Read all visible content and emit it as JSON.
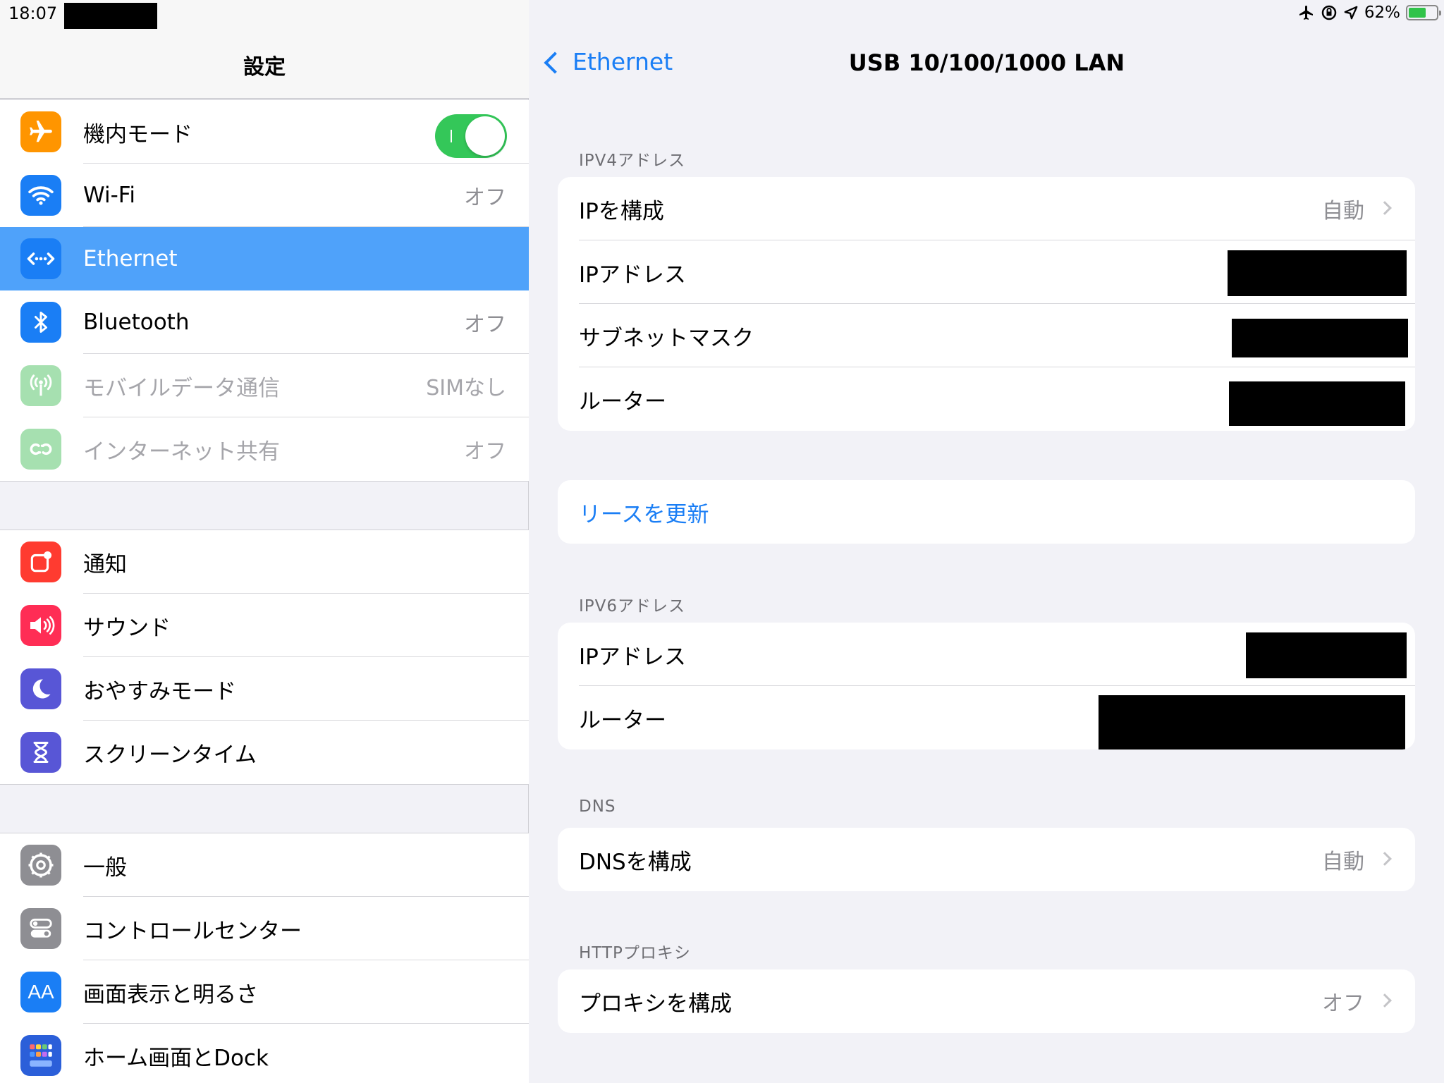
{
  "status_bar": {
    "time": "18:07",
    "battery": "62%",
    "battery_level": 0.62
  },
  "sidebar": {
    "title": "設定",
    "groups": [
      {
        "items": [
          {
            "label": "機内モード",
            "icon": "airplane-icon",
            "color": "#ff9500",
            "toggle": true
          },
          {
            "label": "Wi-Fi",
            "value": "オフ",
            "icon": "wifi-icon",
            "color": "#1a7ef5"
          },
          {
            "label": "Ethernet",
            "icon": "ethernet-icon",
            "color": "#1a7ef5",
            "selected": true
          },
          {
            "label": "Bluetooth",
            "value": "オフ",
            "icon": "bluetooth-icon",
            "color": "#1a7ef5"
          },
          {
            "label": "モバイルデータ通信",
            "value": "SIMなし",
            "icon": "antenna-icon",
            "color": "#a6e0b0",
            "dim": true
          },
          {
            "label": "インターネット共有",
            "value": "オフ",
            "icon": "hotspot-icon",
            "color": "#a6e0b0",
            "dim": true
          }
        ]
      },
      {
        "items": [
          {
            "label": "通知",
            "icon": "notifications-icon",
            "color": "#ff3b30"
          },
          {
            "label": "サウンド",
            "icon": "speaker-icon",
            "color": "#ff2d55"
          },
          {
            "label": "おやすみモード",
            "icon": "moon-icon",
            "color": "#5856d6"
          },
          {
            "label": "スクリーンタイム",
            "icon": "hourglass-icon",
            "color": "#5856d6"
          }
        ]
      },
      {
        "items": [
          {
            "label": "一般",
            "icon": "gear-icon",
            "color": "#8e8e93"
          },
          {
            "label": "コントロールセンター",
            "icon": "switches-icon",
            "color": "#8e8e93"
          },
          {
            "label": "画面表示と明るさ",
            "icon": "text-size-icon",
            "color": "#1a7ef5",
            "glyph": "AA"
          },
          {
            "label": "ホーム画面とDock",
            "icon": "home-grid-icon",
            "color": "#2b5fd9"
          }
        ]
      }
    ]
  },
  "detail": {
    "back_label": "Ethernet",
    "title": "USB 10/100/1000 LAN",
    "ipv4": {
      "title": "IPV4アドレス",
      "configure_label": "IPを構成",
      "configure_value": "自動",
      "address_label": "IPアドレス",
      "subnet_label": "サブネットマスク",
      "router_label": "ルーター"
    },
    "renew_lease": "リースを更新",
    "ipv6": {
      "title": "IPV6アドレス",
      "address_label": "IPアドレス",
      "router_label": "ルーター"
    },
    "dns": {
      "title": "DNS",
      "configure_label": "DNSを構成",
      "configure_value": "自動"
    },
    "proxy": {
      "title": "HTTPプロキシ",
      "configure_label": "プロキシを構成",
      "configure_value": "オフ"
    }
  }
}
